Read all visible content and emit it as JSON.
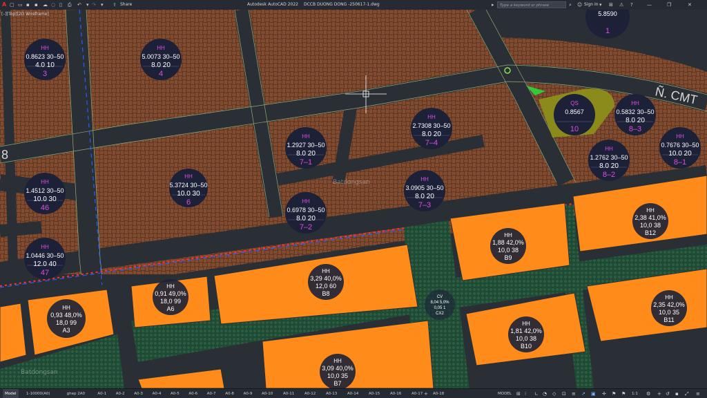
{
  "titlebar": {
    "app_name": "Autodesk AutoCAD 2022",
    "file_name": "DCCB DUONG DONG -250617-1.dwg",
    "share_label": "Share",
    "search_placeholder": "Type a keyword or phrase",
    "sign_in_label": "Sign In"
  },
  "viewport": {
    "label": "[–][Top][2D Wireframe]"
  },
  "watermark": {
    "text": "Batdongsan"
  },
  "road_labels": {
    "left_number": "8",
    "right_text": "Ñ. CMT"
  },
  "plots": [
    {
      "code": "HH",
      "area": "0.8623",
      "height": "30–50",
      "d1": "4.0",
      "d2": "10",
      "id": "3"
    },
    {
      "code": "HH",
      "area": "5.0073",
      "height": "30–50",
      "d1": "8.0",
      "d2": "20",
      "id": "4"
    },
    {
      "code": "HH",
      "area": "1.4512",
      "height": "30–50",
      "d1": "10.0",
      "d2": "30",
      "id": "46"
    },
    {
      "code": "HH",
      "area": "5.3724",
      "height": "30–50",
      "d1": "10.0",
      "d2": "30",
      "id": "6"
    },
    {
      "code": "HH",
      "area": "1.0446",
      "height": "30–50",
      "d1": "12.0",
      "d2": "40",
      "id": "47"
    },
    {
      "code": "HH",
      "area": "1.2927",
      "height": "30–50",
      "d1": "8.0",
      "d2": "20",
      "id": "7–1"
    },
    {
      "code": "HH",
      "area": "0.6978",
      "height": "30–50",
      "d1": "8.0",
      "d2": "20",
      "id": "7–2"
    },
    {
      "code": "HH",
      "area": "2.7308",
      "height": "30–50",
      "d1": "8.0",
      "d2": "20",
      "id": "7–4"
    },
    {
      "code": "HH",
      "area": "3.0905",
      "height": "30–50",
      "d1": "8.0",
      "d2": "20",
      "id": "7–3"
    },
    {
      "code": "QS",
      "area": "0.8567",
      "height": "",
      "d1": "",
      "d2": "",
      "id": "10"
    },
    {
      "code": "HH",
      "area": "0.5832",
      "height": "30–50",
      "d1": "8.0",
      "d2": "20",
      "id": "8–3"
    },
    {
      "code": "HH",
      "area": "1.2762",
      "height": "30–50",
      "d1": "8.0",
      "d2": "20",
      "id": "8–2"
    },
    {
      "code": "HH",
      "area": "0.7676",
      "height": "30–50",
      "d1": "10.0",
      "d2": "20",
      "id": "8–1"
    },
    {
      "code": "",
      "area": "5.8590",
      "height": "",
      "d1": "",
      "d2": "",
      "id": "1"
    }
  ],
  "lots": [
    {
      "code": "HH",
      "area": "0,93",
      "ratio": "48,0%",
      "d1": "18,0",
      "d2": "99",
      "id": "A3"
    },
    {
      "code": "HH",
      "area": "0,91",
      "ratio": "49,0%",
      "d1": "18,0",
      "d2": "99",
      "id": "A6"
    },
    {
      "code": "HH",
      "area": "3,29",
      "ratio": "40,0%",
      "d1": "12,0",
      "d2": "60",
      "id": "B8"
    },
    {
      "code": "HH",
      "area": "1,88",
      "ratio": "42,0%",
      "d1": "10,0",
      "d2": "38",
      "id": "B9"
    },
    {
      "code": "HH",
      "area": "2,38",
      "ratio": "41,0%",
      "d1": "10,0",
      "d2": "38",
      "id": "B12"
    },
    {
      "code": "HH",
      "area": "1,81",
      "ratio": "42,0%",
      "d1": "10,0",
      "d2": "38",
      "id": "B10"
    },
    {
      "code": "HH",
      "area": "2,35",
      "ratio": "42,0%",
      "d1": "10,0",
      "d2": "35",
      "id": "B11"
    },
    {
      "code": "HH",
      "area": "3,09",
      "ratio": "40,0%",
      "d1": "10,0",
      "d2": "35",
      "id": "B7"
    },
    {
      "code": "CV",
      "area": "8,04",
      "ratio": "5,0%",
      "d1": "0,05",
      "d2": "1",
      "id": "CX2"
    }
  ],
  "statusbar": {
    "tabs": [
      "Model",
      "1-10000(A0)",
      "ghep 2A0",
      "A0-1",
      "A0-2",
      "A0-3",
      "A0-4",
      "A0-5",
      "A0-6",
      "A0-7",
      "A0-8",
      "A0-9",
      "A0-10",
      "A0-11",
      "A0-12",
      "A0-13",
      "A0-14",
      "A0-15",
      "A0-16",
      "A0-17",
      "A0-18"
    ],
    "model_label": "MODEL",
    "scale": "1:1"
  },
  "colors": {
    "background_soil": "#5a3a27",
    "road": "#2a2f35",
    "lot_orange": "#ff8c1a",
    "green_strip": "#1f4a34",
    "park": "#8b8b1c",
    "label_magenta": "#d94fd9",
    "label_white": "#ffffff",
    "circle_fill": "#1c2138"
  }
}
